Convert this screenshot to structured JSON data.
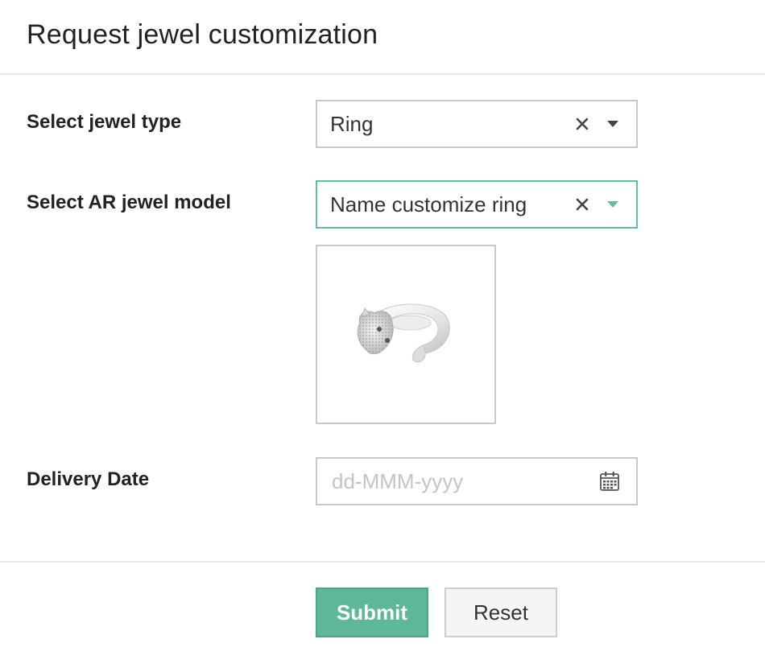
{
  "dialog": {
    "title": "Request jewel customization"
  },
  "form": {
    "jewel_type": {
      "label": "Select jewel type",
      "value": "Ring",
      "clear_icon": "close-icon",
      "caret_icon": "chevron-down-icon"
    },
    "ar_model": {
      "label": "Select AR jewel model",
      "value": "Name customize ring",
      "clear_icon": "close-icon",
      "caret_icon": "chevron-down-icon",
      "accent_color": "#5fbf9f"
    },
    "model_preview": {
      "icon": "ring-image"
    },
    "delivery_date": {
      "label": "Delivery Date",
      "value": "",
      "placeholder": "dd-MMM-yyyy",
      "icon": "calendar-icon"
    }
  },
  "actions": {
    "submit_label": "Submit",
    "reset_label": "Reset",
    "submit_color": "#5cb896"
  }
}
